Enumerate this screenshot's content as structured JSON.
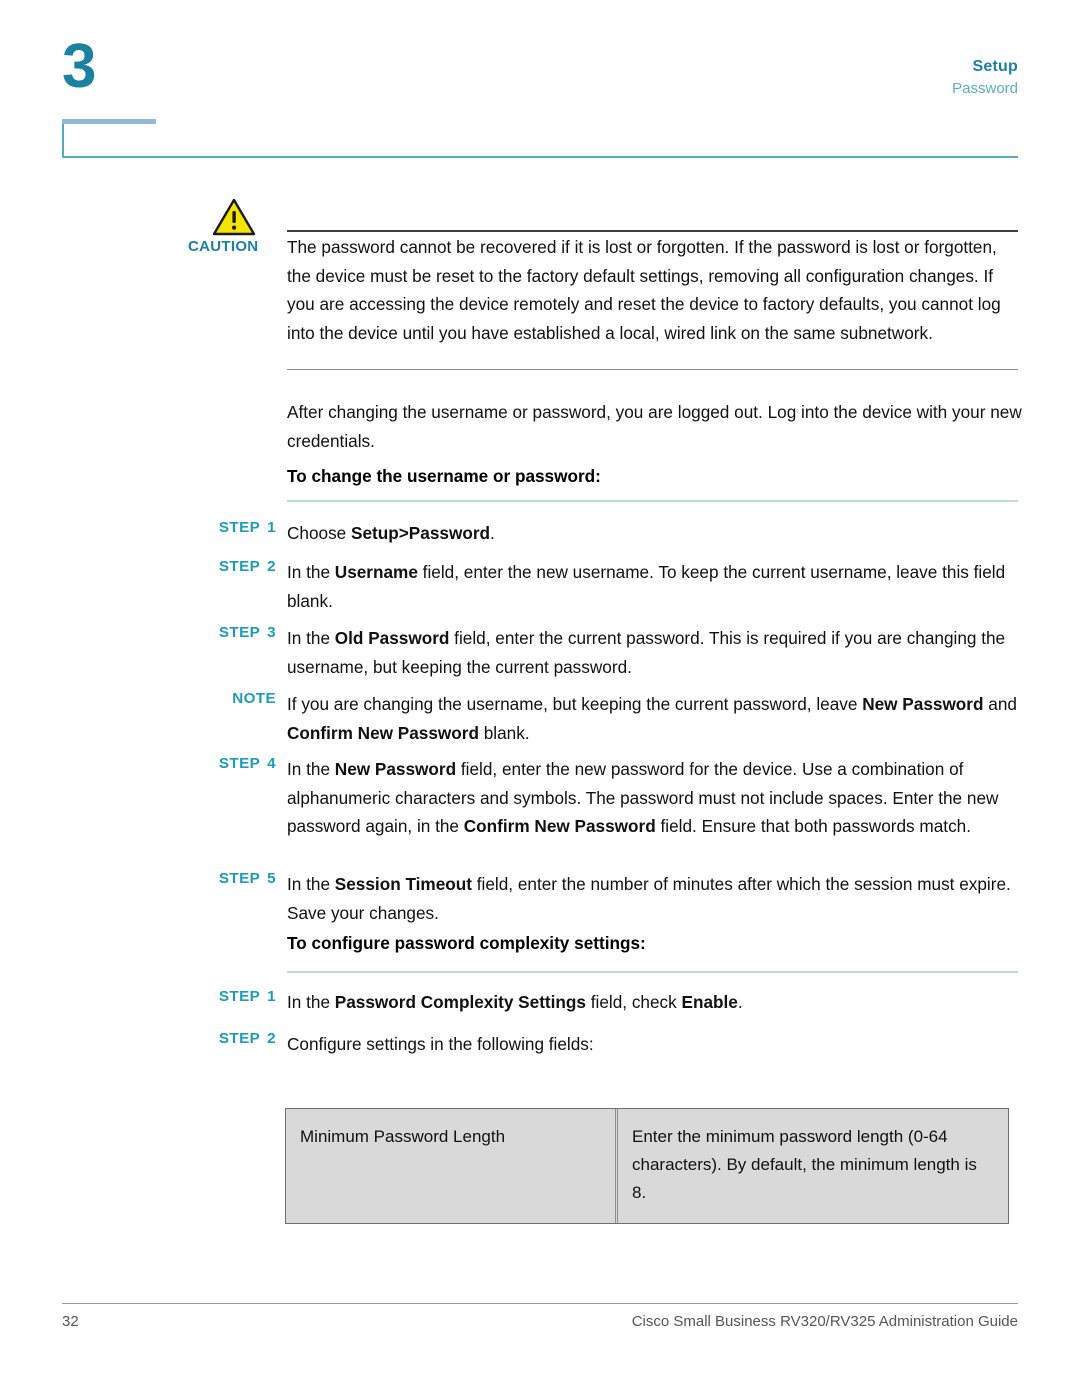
{
  "header": {
    "chapter_number": "3",
    "title": "Setup",
    "subtitle": "Password",
    "accent_color": "#1b81a0",
    "subtitle_color": "#5aafc4",
    "rule_color": "#4fb0b5"
  },
  "caution": {
    "label": "CAUTION",
    "icon": "warning-triangle-icon",
    "text": "The password cannot be recovered if it is lost or forgotten. If the password is lost or forgotten, the device must be reset to the factory default settings, removing all configuration changes. If you are accessing the device remotely and reset the device to factory defaults, you cannot log into the device until you have established a local, wired link on the same subnetwork."
  },
  "intro_paragraph": "After changing the username or password, you are logged out. Log into the device with your new credentials.",
  "section_1": {
    "heading": "To change the username or password:",
    "steps": [
      {
        "tag": "STEP",
        "number": "1",
        "parts": [
          {
            "text": "Choose ",
            "bold": false
          },
          {
            "text": "Setup>Password",
            "bold": true
          },
          {
            "text": ".",
            "bold": false
          }
        ]
      },
      {
        "tag": "STEP",
        "number": "2",
        "parts": [
          {
            "text": "In the ",
            "bold": false
          },
          {
            "text": "Username",
            "bold": true
          },
          {
            "text": " field, enter the new username. To keep the current username, leave this field blank.",
            "bold": false
          }
        ]
      },
      {
        "tag": "STEP",
        "number": "3",
        "parts": [
          {
            "text": "In the ",
            "bold": false
          },
          {
            "text": "Old Password",
            "bold": true
          },
          {
            "text": " field, enter the current password. This is required if you are changing the username, but keeping the current password.",
            "bold": false
          }
        ]
      },
      {
        "tag": "NOTE",
        "number": "",
        "parts": [
          {
            "text": "If you are changing the username, but keeping the current password, leave ",
            "bold": false
          },
          {
            "text": "New Password",
            "bold": true
          },
          {
            "text": " and ",
            "bold": false
          },
          {
            "text": "Confirm New Password",
            "bold": true
          },
          {
            "text": " blank.",
            "bold": false
          }
        ]
      },
      {
        "tag": "STEP",
        "number": "4",
        "parts": [
          {
            "text": "In the ",
            "bold": false
          },
          {
            "text": "New Password",
            "bold": true
          },
          {
            "text": " field, enter the new password for the device. Use a combination of alphanumeric characters and symbols. The password must not include spaces. Enter the new password again, in the ",
            "bold": false
          },
          {
            "text": "Confirm New Password",
            "bold": true
          },
          {
            "text": " field. Ensure that both passwords match.",
            "bold": false
          }
        ]
      },
      {
        "tag": "STEP",
        "number": "5",
        "parts": [
          {
            "text": "In the ",
            "bold": false
          },
          {
            "text": "Session Timeout",
            "bold": true
          },
          {
            "text": " field, enter the number of minutes after which the session must expire. Save your changes.",
            "bold": false
          }
        ]
      }
    ]
  },
  "section_2": {
    "heading": "To configure password complexity settings:",
    "steps": [
      {
        "tag": "STEP",
        "number": "1",
        "parts": [
          {
            "text": "In the ",
            "bold": false
          },
          {
            "text": "Password Complexity Settings",
            "bold": true
          },
          {
            "text": " field, check ",
            "bold": false
          },
          {
            "text": "Enable",
            "bold": true
          },
          {
            "text": ".",
            "bold": false
          }
        ]
      },
      {
        "tag": "STEP",
        "number": "2",
        "parts": [
          {
            "text": "Configure settings in the following fields:",
            "bold": false
          }
        ]
      }
    ]
  },
  "field_table": {
    "rows": [
      {
        "field": "Minimum Password Length",
        "description": "Enter the minimum password length (0-64 characters). By default, the minimum length is 8."
      }
    ]
  },
  "footer": {
    "page_number": "32",
    "guide_title": "Cisco Small Business RV320/RV325 Administration Guide"
  }
}
